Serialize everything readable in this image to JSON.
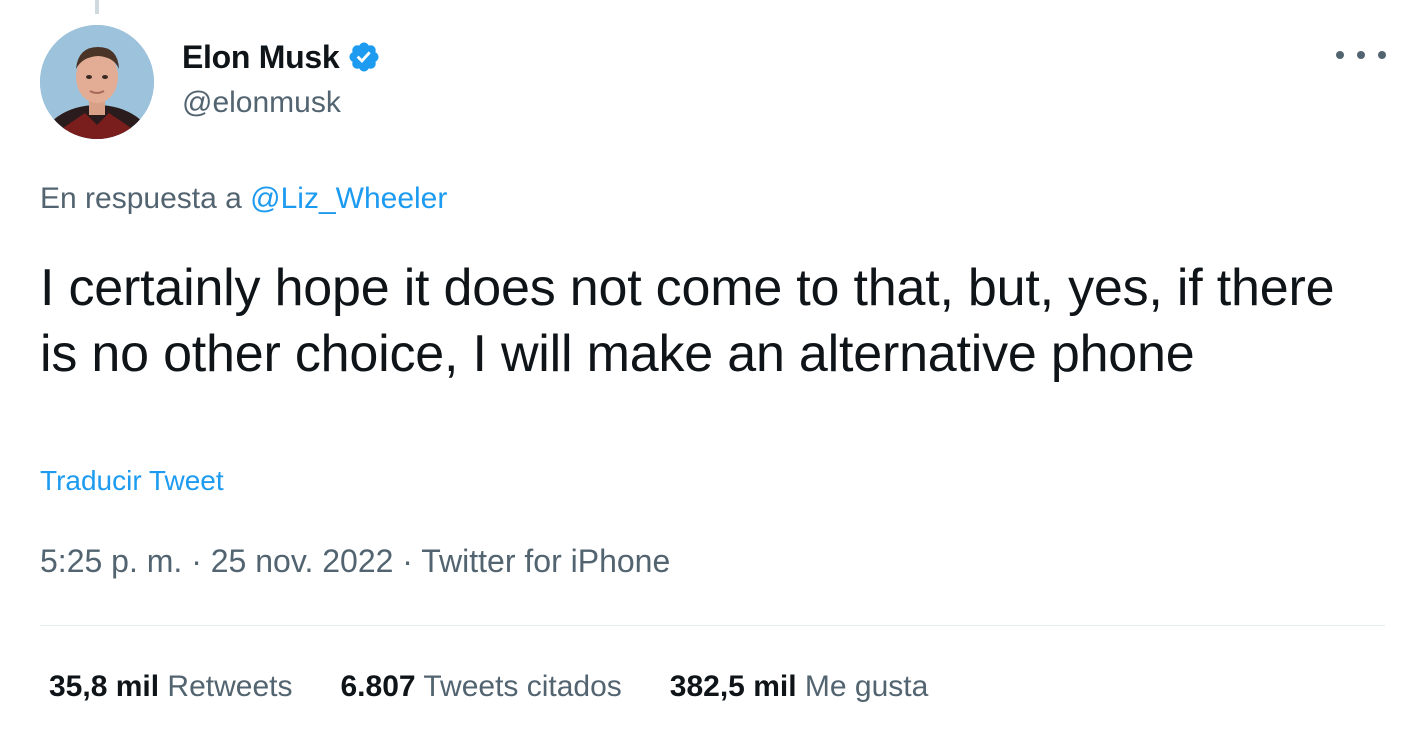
{
  "tweet": {
    "author": {
      "display_name": "Elon Musk",
      "handle": "@elonmusk",
      "verified": true
    },
    "reply_to": {
      "prefix": "En respuesta a",
      "mention": "@Liz_Wheeler"
    },
    "text": "I certainly hope it does not come to that, but, yes, if there is no other choice, I will make an alternative phone",
    "translate_label": "Traducir Tweet",
    "meta": {
      "time": "5:25 p. m.",
      "separator": "·",
      "date": "25 nov. 2022",
      "source": "Twitter for iPhone"
    },
    "stats": [
      {
        "count": "35,8 mil",
        "label": "Retweets"
      },
      {
        "count": "6.807",
        "label": "Tweets citados"
      },
      {
        "count": "382,5 mil",
        "label": "Me gusta"
      }
    ]
  },
  "icons": {
    "verified": "verified-badge-icon",
    "more": "more-options-icon"
  },
  "colors": {
    "accent": "#1d9bf0",
    "text_primary": "#0f1419",
    "text_secondary": "#536471",
    "divider": "#e6ebee"
  }
}
